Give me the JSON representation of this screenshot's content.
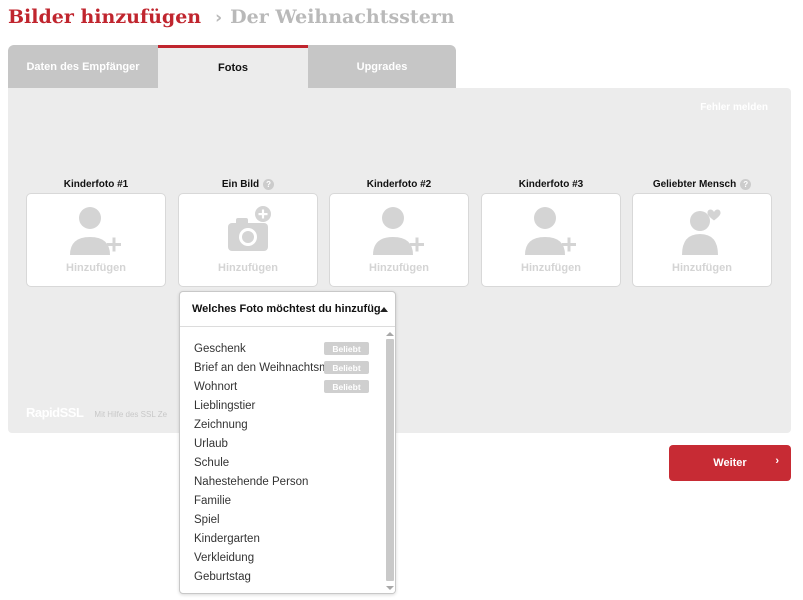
{
  "header": {
    "title": "Bilder hinzufügen",
    "separator": "›",
    "subtitle": "Der Weihnachtsstern"
  },
  "tabs": [
    {
      "label": "Daten des Empfänger",
      "active": false
    },
    {
      "label": "Fotos",
      "active": true
    },
    {
      "label": "Upgrades",
      "active": false
    }
  ],
  "panel": {
    "report_link": "Fehler melden",
    "add_label": "Hinzufügen",
    "help_glyph": "?",
    "slots": [
      {
        "label": "Kinderfoto #1",
        "icon": "child-add-icon",
        "help": false
      },
      {
        "label": "Ein Bild",
        "icon": "camera-add-icon",
        "help": true
      },
      {
        "label": "Kinderfoto #2",
        "icon": "child-add-icon",
        "help": false
      },
      {
        "label": "Kinderfoto #3",
        "icon": "child-add-icon",
        "help": false
      },
      {
        "label": "Geliebter Mensch",
        "icon": "person-heart-icon",
        "help": true
      }
    ],
    "ssl_logo": "RapidSSL",
    "ssl_text": "Mit Hilfe des SSL Ze"
  },
  "dropdown": {
    "heading": "Welches Foto möchtest du hinzufüg…",
    "badge_label": "Beliebt",
    "options": [
      {
        "label": "Geschenk",
        "popular": true
      },
      {
        "label": "Brief an den Weihnachtsm",
        "popular": true
      },
      {
        "label": "Wohnort",
        "popular": true
      },
      {
        "label": "Lieblingstier",
        "popular": false
      },
      {
        "label": "Zeichnung",
        "popular": false
      },
      {
        "label": "Urlaub",
        "popular": false
      },
      {
        "label": "Schule",
        "popular": false
      },
      {
        "label": "Nahestehende Person",
        "popular": false
      },
      {
        "label": "Familie",
        "popular": false
      },
      {
        "label": "Spiel",
        "popular": false
      },
      {
        "label": "Kindergarten",
        "popular": false
      },
      {
        "label": "Verkleidung",
        "popular": false
      },
      {
        "label": "Geburtstag",
        "popular": false
      }
    ]
  },
  "footer": {
    "next_label": "Weiter",
    "next_arrow": "›"
  },
  "colors": {
    "brand_red": "#c0252e",
    "button_red": "#c72b34",
    "panel_bg": "#ececec",
    "tab_inactive": "#c6c6c6",
    "icon_gray": "#d4d4d4"
  }
}
